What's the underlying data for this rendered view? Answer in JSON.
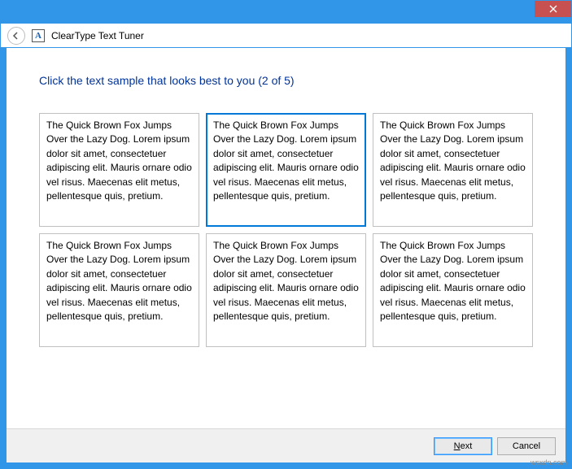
{
  "window": {
    "title": "ClearType Text Tuner",
    "app_icon_letter": "A"
  },
  "instruction": "Click the text sample that looks best to you (2 of 5)",
  "sample_text": "The Quick Brown Fox Jumps Over the Lazy Dog. Lorem ipsum dolor sit amet, consectetuer adipiscing elit. Mauris ornare odio vel risus. Maecenas elit metus, pellentesque quis, pretium.",
  "selected_index": 1,
  "buttons": {
    "next": "Next",
    "cancel": "Cancel"
  },
  "watermark": "wsxdn.com"
}
